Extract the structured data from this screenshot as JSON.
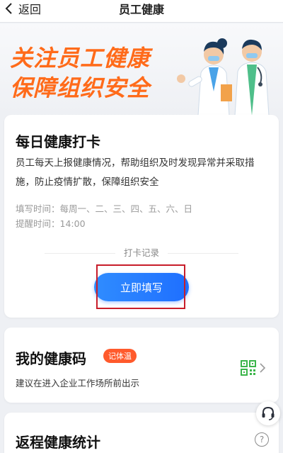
{
  "nav": {
    "back_label": "返回",
    "title": "员工健康"
  },
  "banner": {
    "line1": "关注员工健康",
    "line2": "保障组织安全"
  },
  "checkin": {
    "title": "每日健康打卡",
    "description": "员工每天上报健康情况，帮助组织及时发现异常并采取措施，防止疫情扩散，保障组织安全",
    "fill_time": "填写时间：每周一、二、三、四、五、六、日",
    "remind_time": "提醒时间：14:00",
    "record_link": "打卡记录",
    "fill_button": "立即填写"
  },
  "health_code": {
    "title": "我的健康码",
    "tag": "记体温",
    "subtitle": "建议在进入企业工作场所前出示"
  },
  "return_stats": {
    "title": "返程健康统计",
    "help": "?"
  },
  "colors": {
    "accent_orange": "#ff6b1a",
    "primary_blue": "#1f6fff",
    "tag_red": "#ff5a2c",
    "highlight_red": "#c81d2a",
    "qr_green": "#3bb54a"
  }
}
